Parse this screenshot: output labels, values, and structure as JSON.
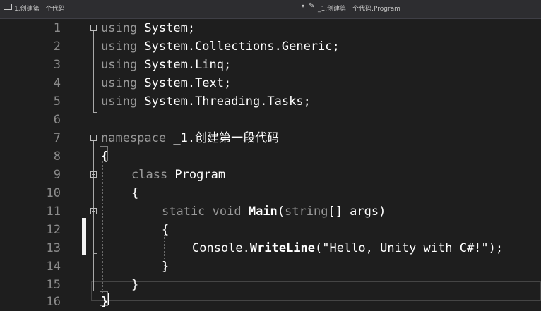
{
  "topbar": {
    "project_label": "1.创建第一个代码",
    "dropdown_arrow": "▾",
    "member_label": "_1.创建第一个代码.Program",
    "project_icon": "csharp-project-icon",
    "member_icon": "class-member-icon"
  },
  "editor": {
    "theme": {
      "background": "#1e1e1e",
      "keyword": "#9a9a9a",
      "identifier": "#ffffff",
      "line_number": "#8a8a8a"
    },
    "lines": [
      {
        "num": "1",
        "kw": "using",
        "text": " System;"
      },
      {
        "num": "2",
        "kw": "using",
        "text": " System.Collections.Generic;"
      },
      {
        "num": "3",
        "kw": "using",
        "text": " System.Linq;"
      },
      {
        "num": "4",
        "kw": "using",
        "text": " System.Text;"
      },
      {
        "num": "5",
        "kw": "using",
        "text": " System.Threading.Tasks;"
      },
      {
        "num": "6"
      },
      {
        "num": "7",
        "kw": "namespace",
        "ns": " _1.",
        "cn": "创建第一段代码"
      },
      {
        "num": "8",
        "text": "{"
      },
      {
        "num": "9",
        "kw": "class",
        "text": " Program"
      },
      {
        "num": "10",
        "text": "{"
      },
      {
        "num": "11",
        "kw": "static void",
        "method": " Main",
        "open": "(",
        "kw2": "string",
        "params": "[] args",
        "close": ")"
      },
      {
        "num": "12",
        "text": "{"
      },
      {
        "num": "13",
        "text": "Console.",
        "method": "WriteLine",
        "args": "(\"Hello, Unity with C#!\");"
      },
      {
        "num": "14",
        "text": "}"
      },
      {
        "num": "15",
        "text": "}"
      },
      {
        "num": "16",
        "text": "}"
      }
    ]
  }
}
